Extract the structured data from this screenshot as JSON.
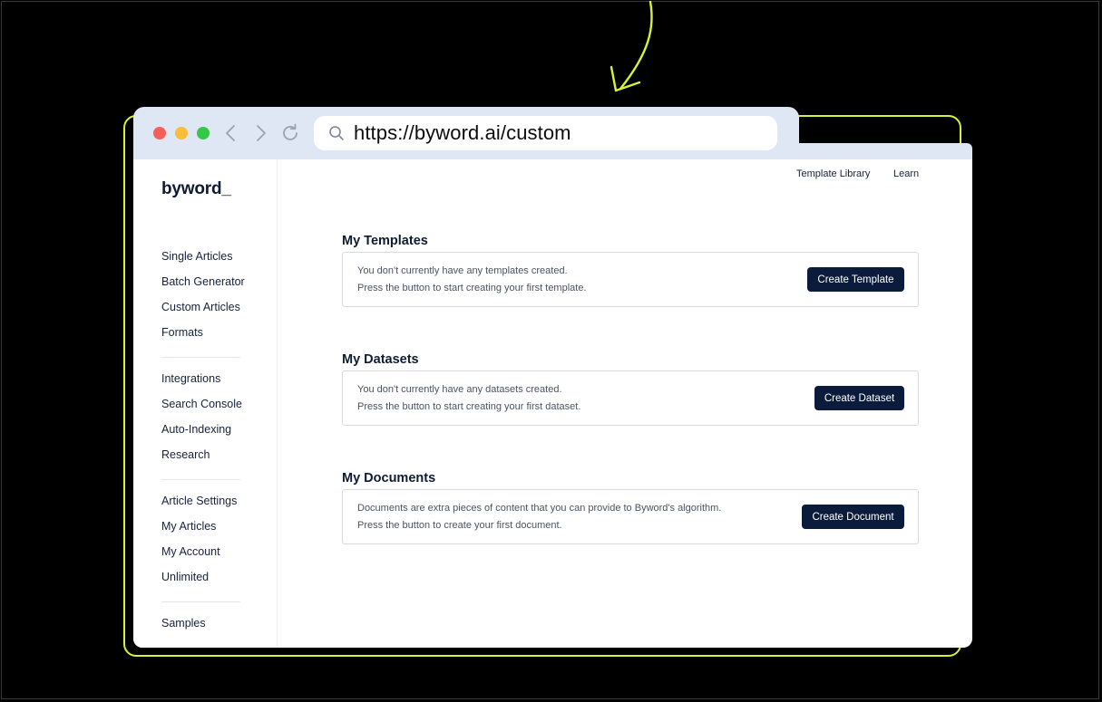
{
  "browser": {
    "url": "https://byword.ai/custom"
  },
  "sidebar": {
    "logo": "byword_",
    "groups": [
      [
        "Single Articles",
        "Batch Generator",
        "Custom Articles",
        "Formats"
      ],
      [
        "Integrations",
        "Search Console",
        "Auto-Indexing",
        "Research"
      ],
      [
        "Article Settings",
        "My Articles",
        "My Account",
        "Unlimited"
      ],
      [
        "Samples"
      ]
    ]
  },
  "topnav": {
    "template_library": "Template Library",
    "learn": "Learn"
  },
  "sections": {
    "templates": {
      "title": "My Templates",
      "line1": "You don't currently have any templates created.",
      "line2": "Press the button to start creating your first template.",
      "button": "Create Template"
    },
    "datasets": {
      "title": "My Datasets",
      "line1": "You don't currently have any datasets created.",
      "line2": "Press the button to start creating your first dataset.",
      "button": "Create Dataset"
    },
    "documents": {
      "title": "My Documents",
      "line1": "Documents are extra pieces of content that you can provide to Byword's algorithm.",
      "line2": "Press the button to create your first document.",
      "button": "Create Document"
    }
  },
  "colors": {
    "accent_frame": "#d4f23a",
    "button_bg": "#0b1b3b",
    "titlebar": "#dfe6f4"
  }
}
